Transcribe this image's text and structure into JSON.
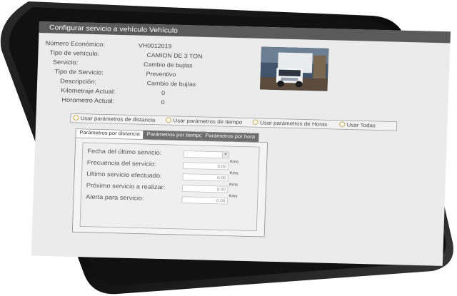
{
  "window": {
    "title": "Configurar servicio a vehículo Vehículo"
  },
  "vehicle": {
    "fields": [
      {
        "label": "Número Económico:",
        "value": "VH0012019"
      },
      {
        "label": "Tipo de vehículo:",
        "value": "CAMION DE 3 TON"
      },
      {
        "label": "Servicio:",
        "value": "Cambio de bujías"
      },
      {
        "label": "Tipo de Servicio:",
        "value": "Preventivo"
      },
      {
        "label": "Descripción:",
        "value": "Cambio de bujías"
      },
      {
        "label": "Kilometraje Actual:",
        "value": "0"
      },
      {
        "label": "Horometro Actual:",
        "value": "0"
      }
    ]
  },
  "options": [
    "Usar parámetros de distancia",
    "Usar parámetros de tiempo",
    "Usar parámetros de Horas",
    "Usar Todas"
  ],
  "tabs": [
    "Parámetros por distancia",
    "Parámetros por tiempo",
    "Parámetros por hora"
  ],
  "form": {
    "labels": [
      "Fecha del último servicio:",
      "Frecuencia del servicio:",
      "Último servicio efectuado:",
      "Próximo servicio a realizar:",
      "Alerta para servicio:"
    ],
    "value": "0.00",
    "unit": "Kms"
  },
  "colors": {
    "titlebar": "#5a5a5a",
    "screen_bg": "#ebebeb",
    "bezel": "#111111"
  }
}
